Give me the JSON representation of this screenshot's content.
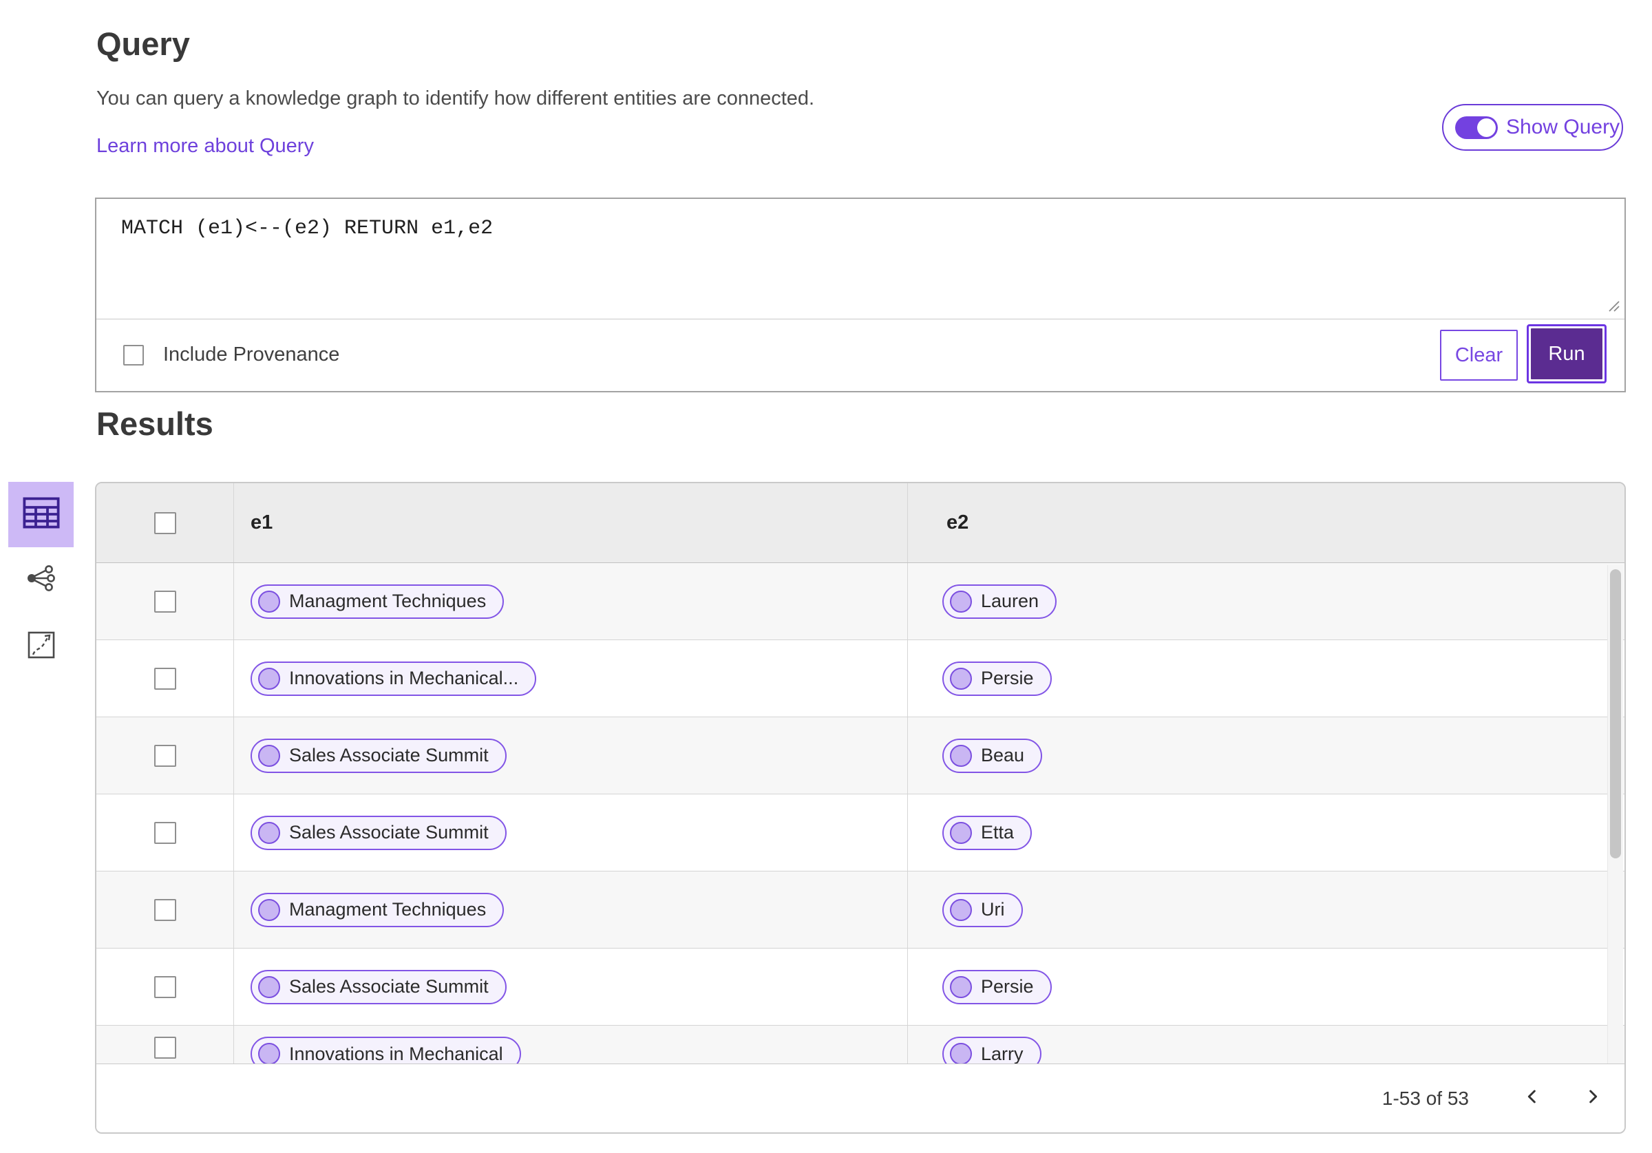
{
  "query_section": {
    "title": "Query",
    "description": "You can query a knowledge graph to identify how different entities are connected.",
    "learn_more_link": "Learn more about Query",
    "show_query_toggle": {
      "label": "Show Query",
      "state": "on"
    },
    "editor_text": "MATCH (e1)<--(e2) RETURN e1,e2",
    "include_provenance_label": "Include Provenance",
    "buttons": {
      "clear": "Clear",
      "run": "Run"
    }
  },
  "results_section": {
    "title": "Results",
    "view_switcher": [
      {
        "icon": "table-view-icon",
        "active": true
      },
      {
        "icon": "graph-view-icon",
        "active": false
      },
      {
        "icon": "expand-view-icon",
        "active": false
      }
    ],
    "table": {
      "columns": [
        "e1",
        "e2"
      ],
      "rows": [
        {
          "e1": "Managment Techniques",
          "e2": "Lauren"
        },
        {
          "e1": "Innovations in Mechanical...",
          "e2": "Persie"
        },
        {
          "e1": "Sales Associate Summit",
          "e2": "Beau"
        },
        {
          "e1": "Sales Associate Summit",
          "e2": "Etta"
        },
        {
          "e1": "Managment Techniques",
          "e2": "Uri"
        },
        {
          "e1": "Sales Associate Summit",
          "e2": "Persie"
        },
        {
          "e1": "Innovations in Mechanical",
          "e2": "Larry"
        }
      ]
    },
    "pagination": {
      "range_text": "1-53 of 53",
      "prev_icon": "chevron-left-icon",
      "next_icon": "chevron-right-icon"
    }
  },
  "colors": {
    "accent_purple": "#6a3bd8",
    "run_button_fill": "#5b2c91",
    "active_view_bg": "#cdb9f6",
    "pill_border": "#8255e6",
    "pill_bg": "#f5f2fd",
    "pill_circle_fill": "#c9b6f3",
    "header_row_bg": "#ececec",
    "striped_row_bg": "#f7f7f7"
  }
}
